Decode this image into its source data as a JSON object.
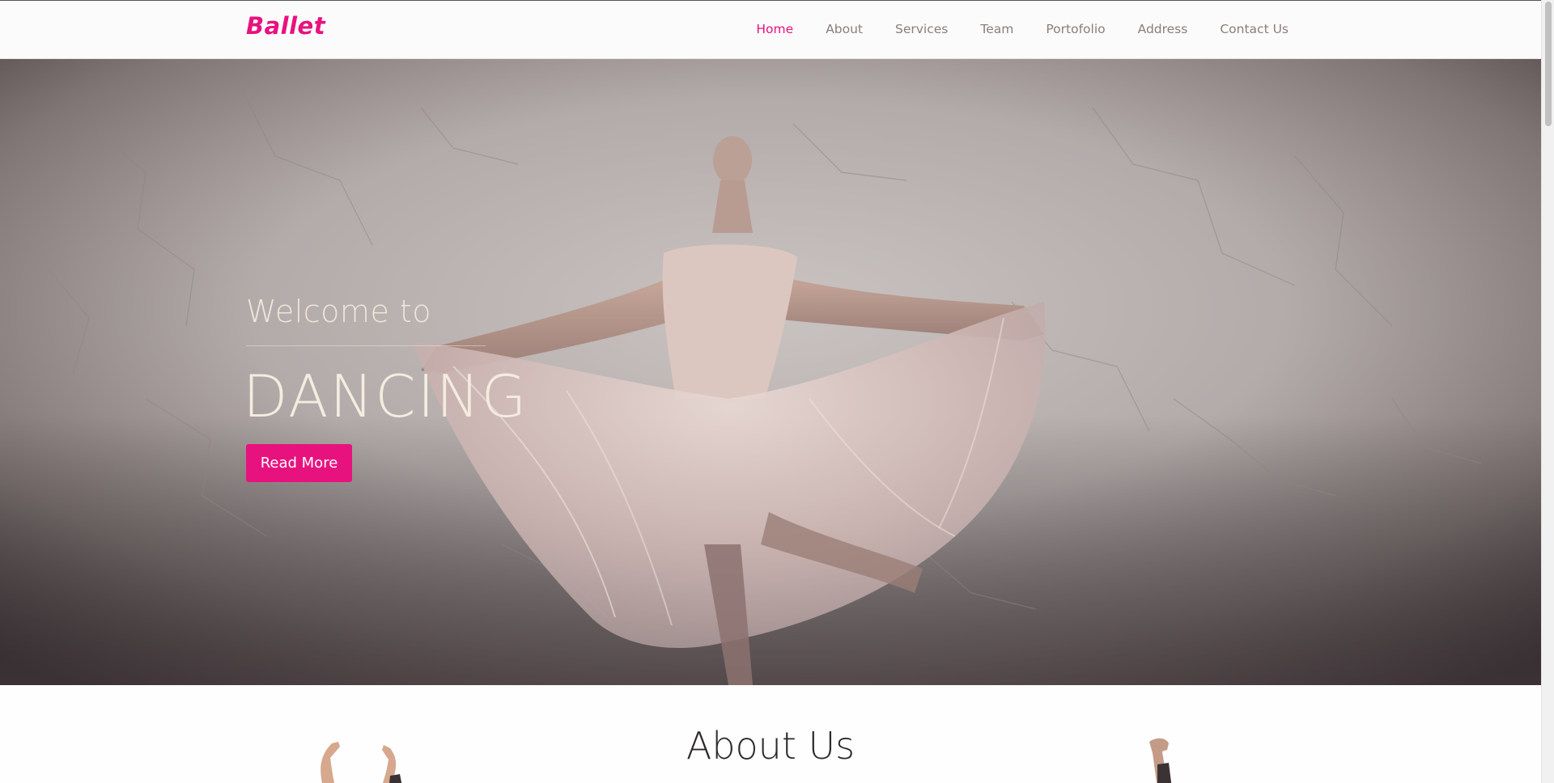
{
  "brand": {
    "logo": "Ballet",
    "accent": "#e8127f"
  },
  "nav": {
    "items": [
      {
        "label": "Home",
        "active": true
      },
      {
        "label": "About",
        "active": false
      },
      {
        "label": "Services",
        "active": false
      },
      {
        "label": "Team",
        "active": false
      },
      {
        "label": "Portofolio",
        "active": false
      },
      {
        "label": "Address",
        "active": false
      },
      {
        "label": "Contact Us",
        "active": false
      }
    ]
  },
  "hero": {
    "welcome": "Welcome to",
    "title": "DANCING",
    "button_label": "Read More"
  },
  "about": {
    "title": "About Us"
  }
}
